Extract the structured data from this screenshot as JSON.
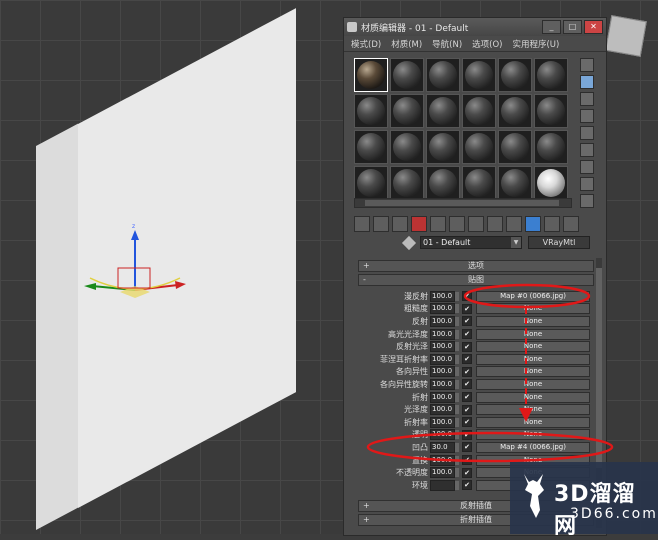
{
  "viewport": {
    "nav_cube_label": ""
  },
  "window": {
    "title": "材质编辑器 - 01 - Default",
    "minimize": "_",
    "maximize": "□",
    "close": "✕"
  },
  "menu": [
    "模式(D)",
    "材质(M)",
    "导航(N)",
    "选项(O)",
    "实用程序(U)"
  ],
  "material": {
    "name": "01 - Default",
    "type": "VRayMtl"
  },
  "rollouts": {
    "options": "选项",
    "maps": "贴图",
    "reflect_interp": "反射插值",
    "refract_interp": "折射插值"
  },
  "maps": [
    {
      "name": "漫反射",
      "amount": "100.0",
      "checked": "✔",
      "map": "Map #0 (0066.jpg)"
    },
    {
      "name": "粗糙度",
      "amount": "100.0",
      "checked": "✔",
      "map": "None"
    },
    {
      "name": "反射",
      "amount": "100.0",
      "checked": "✔",
      "map": "None"
    },
    {
      "name": "高光光泽度",
      "amount": "100.0",
      "checked": "✔",
      "map": "None"
    },
    {
      "name": "反射光泽",
      "amount": "100.0",
      "checked": "✔",
      "map": "None"
    },
    {
      "name": "菲涅耳折射率",
      "amount": "100.0",
      "checked": "✔",
      "map": "None"
    },
    {
      "name": "各向异性",
      "amount": "100.0",
      "checked": "✔",
      "map": "None"
    },
    {
      "name": "各向异性旋转",
      "amount": "100.0",
      "checked": "✔",
      "map": "None"
    },
    {
      "name": "折射",
      "amount": "100.0",
      "checked": "✔",
      "map": "None"
    },
    {
      "name": "光泽度",
      "amount": "100.0",
      "checked": "✔",
      "map": "None"
    },
    {
      "name": "折射率",
      "amount": "100.0",
      "checked": "✔",
      "map": "None"
    },
    {
      "name": "透明",
      "amount": "100.0",
      "checked": "✔",
      "map": "None"
    },
    {
      "name": "凹凸",
      "amount": "30.0",
      "checked": "✔",
      "map": "Map #4 (0066.jpg)"
    },
    {
      "name": "置换",
      "amount": "100.0",
      "checked": "✔",
      "map": "None"
    },
    {
      "name": "不透明度",
      "amount": "100.0",
      "checked": "✔",
      "map": "None"
    },
    {
      "name": "环境",
      "amount": "",
      "checked": "✔",
      "map": ""
    }
  ],
  "watermark": {
    "line1": "3D溜溜网",
    "line2": "3D66.com"
  },
  "colors": {
    "annotation": "#e01818",
    "accent": "#3b7fd0"
  }
}
